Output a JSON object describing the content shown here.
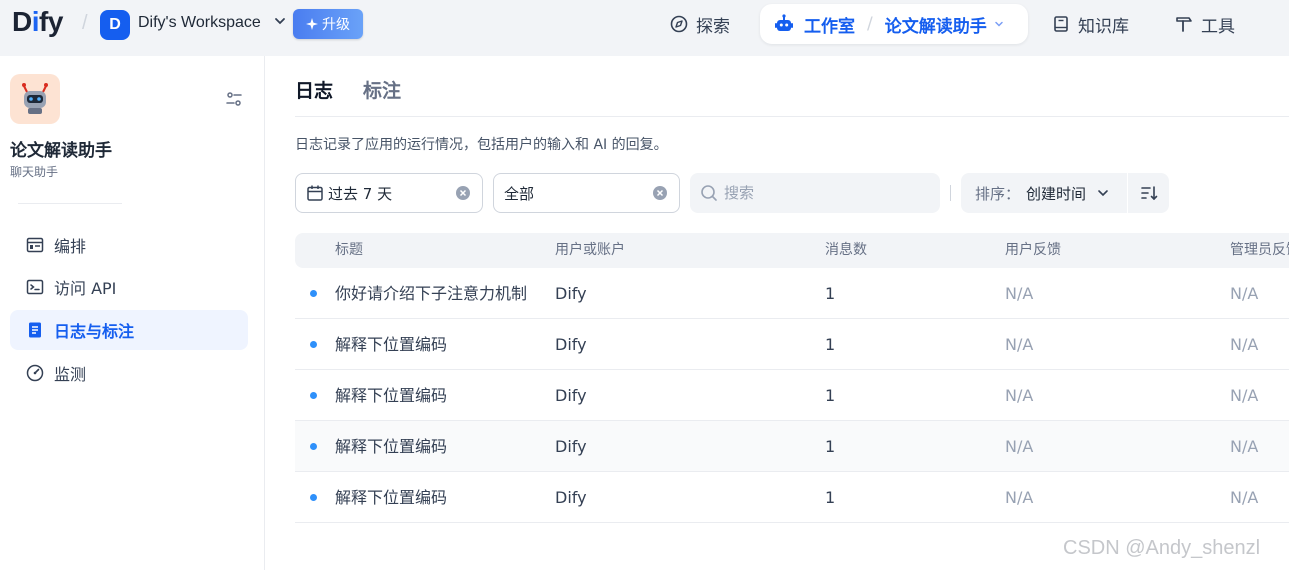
{
  "topbar": {
    "logo_prefix": "D",
    "logo_i": "i",
    "logo_suffix": "fy",
    "workspace_initial": "D",
    "workspace_name": "Dify's Workspace",
    "upgrade_label": "升级",
    "nav": {
      "explore": "探索",
      "studio": "工作室",
      "current_app": "论文解读助手",
      "knowledge": "知识库",
      "tools": "工具"
    }
  },
  "sidebar": {
    "app_name": "论文解读助手",
    "app_type": "聊天助手",
    "items": [
      {
        "label": "编排",
        "icon": "layout-icon",
        "active": false
      },
      {
        "label": "访问 API",
        "icon": "terminal-icon",
        "active": false
      },
      {
        "label": "日志与标注",
        "icon": "file-text-icon",
        "active": true
      },
      {
        "label": "监测",
        "icon": "gauge-icon",
        "active": false
      }
    ]
  },
  "main": {
    "tabs": [
      "日志",
      "标注"
    ],
    "active_tab": "日志",
    "description": "日志记录了应用的运行情况，包括用户的输入和 AI 的回复。",
    "filters": {
      "period": "过去 7 天",
      "status": "全部",
      "search_placeholder": "搜索",
      "sort_label": "排序：",
      "sort_value": "创建时间"
    },
    "table": {
      "headers": [
        "标题",
        "用户或账户",
        "消息数",
        "用户反馈",
        "管理员反馈"
      ],
      "rows": [
        {
          "title": "你好请介绍下子注意力机制",
          "user": "Dify",
          "messages": "1",
          "user_feedback": "N/A",
          "admin_feedback": "N/A"
        },
        {
          "title": "解释下位置编码",
          "user": "Dify",
          "messages": "1",
          "user_feedback": "N/A",
          "admin_feedback": "N/A"
        },
        {
          "title": "解释下位置编码",
          "user": "Dify",
          "messages": "1",
          "user_feedback": "N/A",
          "admin_feedback": "N/A"
        },
        {
          "title": "解释下位置编码",
          "user": "Dify",
          "messages": "1",
          "user_feedback": "N/A",
          "admin_feedback": "N/A"
        },
        {
          "title": "解释下位置编码",
          "user": "Dify",
          "messages": "1",
          "user_feedback": "N/A",
          "admin_feedback": "N/A"
        }
      ]
    }
  },
  "watermark": "CSDN @Andy_shenzl",
  "colors": {
    "accent": "#155eef",
    "unread_dot": "#2e90fa",
    "muted": "#98a2b3"
  }
}
